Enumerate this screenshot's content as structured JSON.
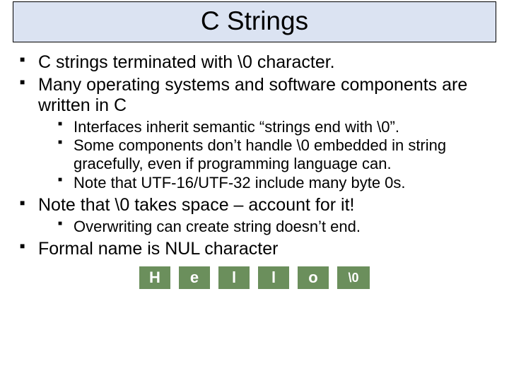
{
  "title": "C Strings",
  "bullets": {
    "b1": "C strings terminated with \\0 character.",
    "b2": "Many operating systems and software components are written in C",
    "b2_sub1": "Interfaces inherit semantic “strings end with \\0”.",
    "b2_sub2": "Some components don’t handle \\0 embedded in string gracefully, even if programming language can.",
    "b2_sub3": "Note that UTF-16/UTF-32 include many byte 0s.",
    "b3": "Note that \\0 takes space – account for it!",
    "b3_sub1": "Overwriting can create string doesn’t end.",
    "b4": "Formal name is NUL character"
  },
  "cells": [
    "H",
    "e",
    "l",
    "l",
    "o",
    "\\0"
  ]
}
